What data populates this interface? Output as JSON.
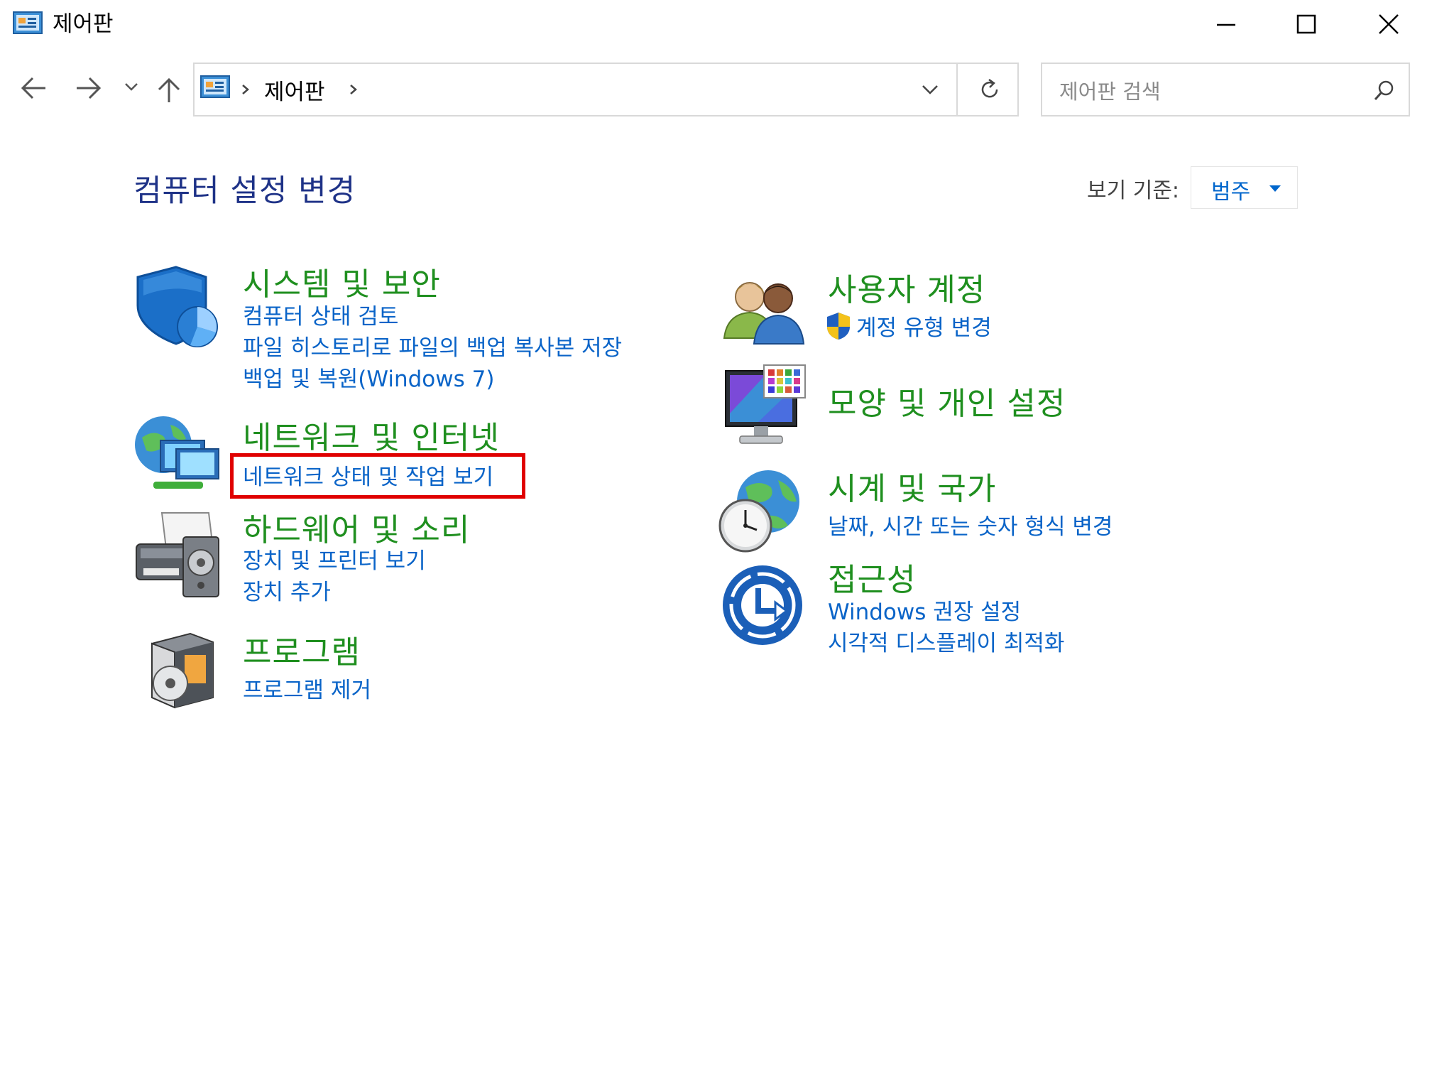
{
  "window": {
    "title": "제어판"
  },
  "address_bar": {
    "breadcrumb": [
      "제어판"
    ]
  },
  "search": {
    "placeholder": "제어판 검색"
  },
  "page": {
    "title": "컴퓨터 설정 변경",
    "view_by_label": "보기 기준:",
    "view_by_value": "범주"
  },
  "categories": {
    "system_security": {
      "title": "시스템 및 보안",
      "links": [
        "컴퓨터 상태 검토",
        "파일 히스토리로 파일의 백업 복사본 저장",
        "백업 및 복원(Windows 7)"
      ]
    },
    "network": {
      "title": "네트워크 및 인터넷",
      "links": [
        "네트워크 상태 및 작업 보기"
      ]
    },
    "hardware": {
      "title": "하드웨어 및 소리",
      "links": [
        "장치 및 프린터 보기",
        "장치 추가"
      ]
    },
    "programs": {
      "title": "프로그램",
      "links": [
        "프로그램 제거"
      ]
    },
    "user_accounts": {
      "title": "사용자 계정",
      "links": [
        "계정 유형 변경"
      ]
    },
    "appearance": {
      "title": "모양 및 개인 설정",
      "links": []
    },
    "clock_region": {
      "title": "시계 및 국가",
      "links": [
        "날짜, 시간 또는 숫자 형식 변경"
      ]
    },
    "accessibility": {
      "title": "접근성",
      "links": [
        "Windows 권장 설정",
        "시각적 디스플레이 최적화"
      ]
    }
  },
  "colors": {
    "category_title": "#1f8f1f",
    "link": "#0a64c8",
    "page_title": "#1e3287",
    "highlight": "#e00000"
  },
  "icons": [
    "control-panel-icon",
    "minimize-icon",
    "maximize-icon",
    "close-icon",
    "back-arrow-icon",
    "forward-arrow-icon",
    "recent-chevron-icon",
    "up-arrow-icon",
    "refresh-icon",
    "search-icon",
    "dropdown-arrow-icon",
    "shield-icon",
    "network-globe-icon",
    "printer-icon",
    "programs-box-icon",
    "users-icon",
    "uac-shield-icon",
    "monitor-palette-icon",
    "globe-clock-icon",
    "accessibility-icon"
  ]
}
